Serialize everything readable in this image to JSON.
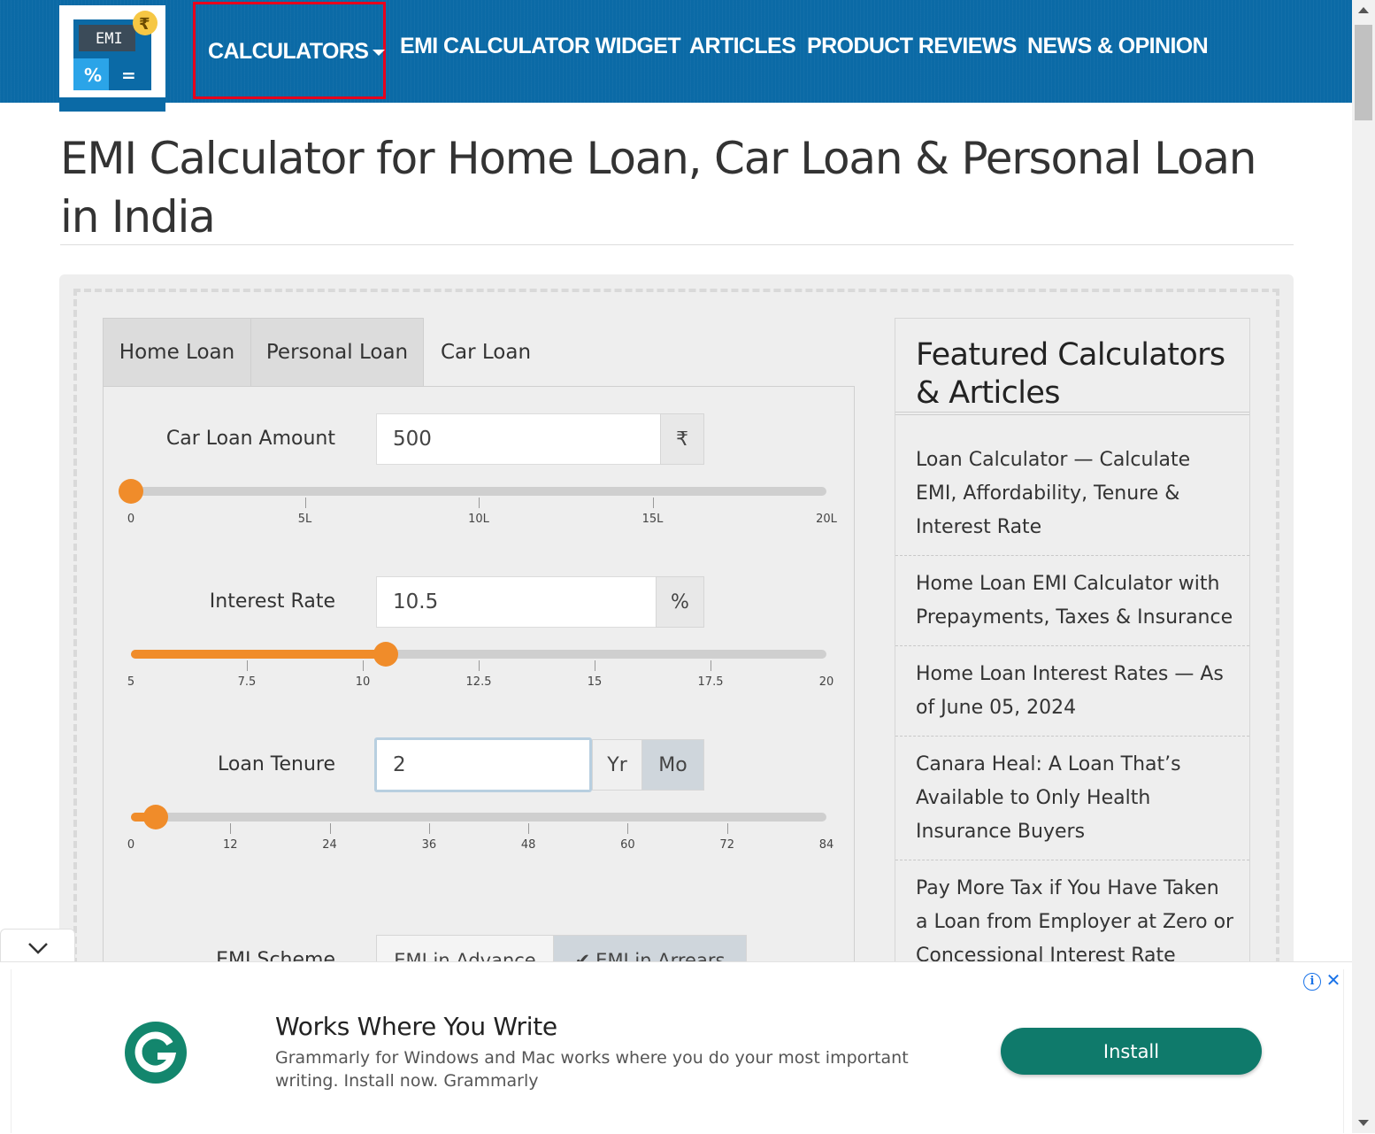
{
  "nav": {
    "logo_text": "EMI",
    "links": {
      "calculators": "CALCULATORS",
      "widget": "EMI CALCULATOR WIDGET",
      "articles": "ARTICLES",
      "reviews": "PRODUCT REVIEWS",
      "news": "NEWS & OPINION"
    },
    "colors": {
      "bar": "#0b6aa6",
      "highlight": "#e8001c"
    }
  },
  "page": {
    "title": "EMI Calculator for Home Loan, Car Loan & Personal Loan in India"
  },
  "tabs": [
    {
      "label": "Home Loan",
      "active": false
    },
    {
      "label": "Personal Loan",
      "active": false
    },
    {
      "label": "Car Loan",
      "active": true
    }
  ],
  "form": {
    "amount": {
      "label": "Car Loan Amount",
      "value": "500",
      "unit": "₹",
      "slider_fraction": 0.0,
      "ticks": [
        "0",
        "5L",
        "10L",
        "15L",
        "20L"
      ]
    },
    "rate": {
      "label": "Interest Rate",
      "value": "10.5",
      "unit": "%",
      "slider_fraction": 0.367,
      "ticks": [
        "5",
        "7.5",
        "10",
        "12.5",
        "15",
        "17.5",
        "20"
      ]
    },
    "tenure": {
      "label": "Loan Tenure",
      "value": "2",
      "unit_year": "Yr",
      "unit_month": "Mo",
      "selected_unit": "Mo",
      "slider_fraction": 0.036,
      "ticks": [
        "0",
        "12",
        "24",
        "36",
        "48",
        "60",
        "72",
        "84"
      ]
    },
    "scheme": {
      "label": "EMI Scheme",
      "options": [
        "EMI in Advance",
        "EMI in Arrears"
      ],
      "selected": "EMI in Arrears"
    },
    "accent": "#f08c2a"
  },
  "sidebar": {
    "heading": "Featured Calculators & Articles",
    "links": [
      "Loan Calculator — Calculate EMI, Affordability, Tenure & Interest Rate",
      "Home Loan EMI Calculator with Prepayments, Taxes & Insurance",
      "Home Loan Interest Rates — As of June 05, 2024",
      "Canara Heal: A Loan That’s Available to Only Health Insurance Buyers",
      "Pay More Tax if You Have Taken a Loan from Employer at Zero or Concessional Interest Rate"
    ]
  },
  "ad": {
    "title": "Works Where You Write",
    "body": "Grammarly for Windows and Mac works where you do your most important writing. Install now. Grammarly",
    "button": "Install",
    "brand_color": "#0f7a6b",
    "icons": [
      "info-icon",
      "close-icon",
      "chevron-down-icon",
      "grammarly-logo"
    ]
  }
}
